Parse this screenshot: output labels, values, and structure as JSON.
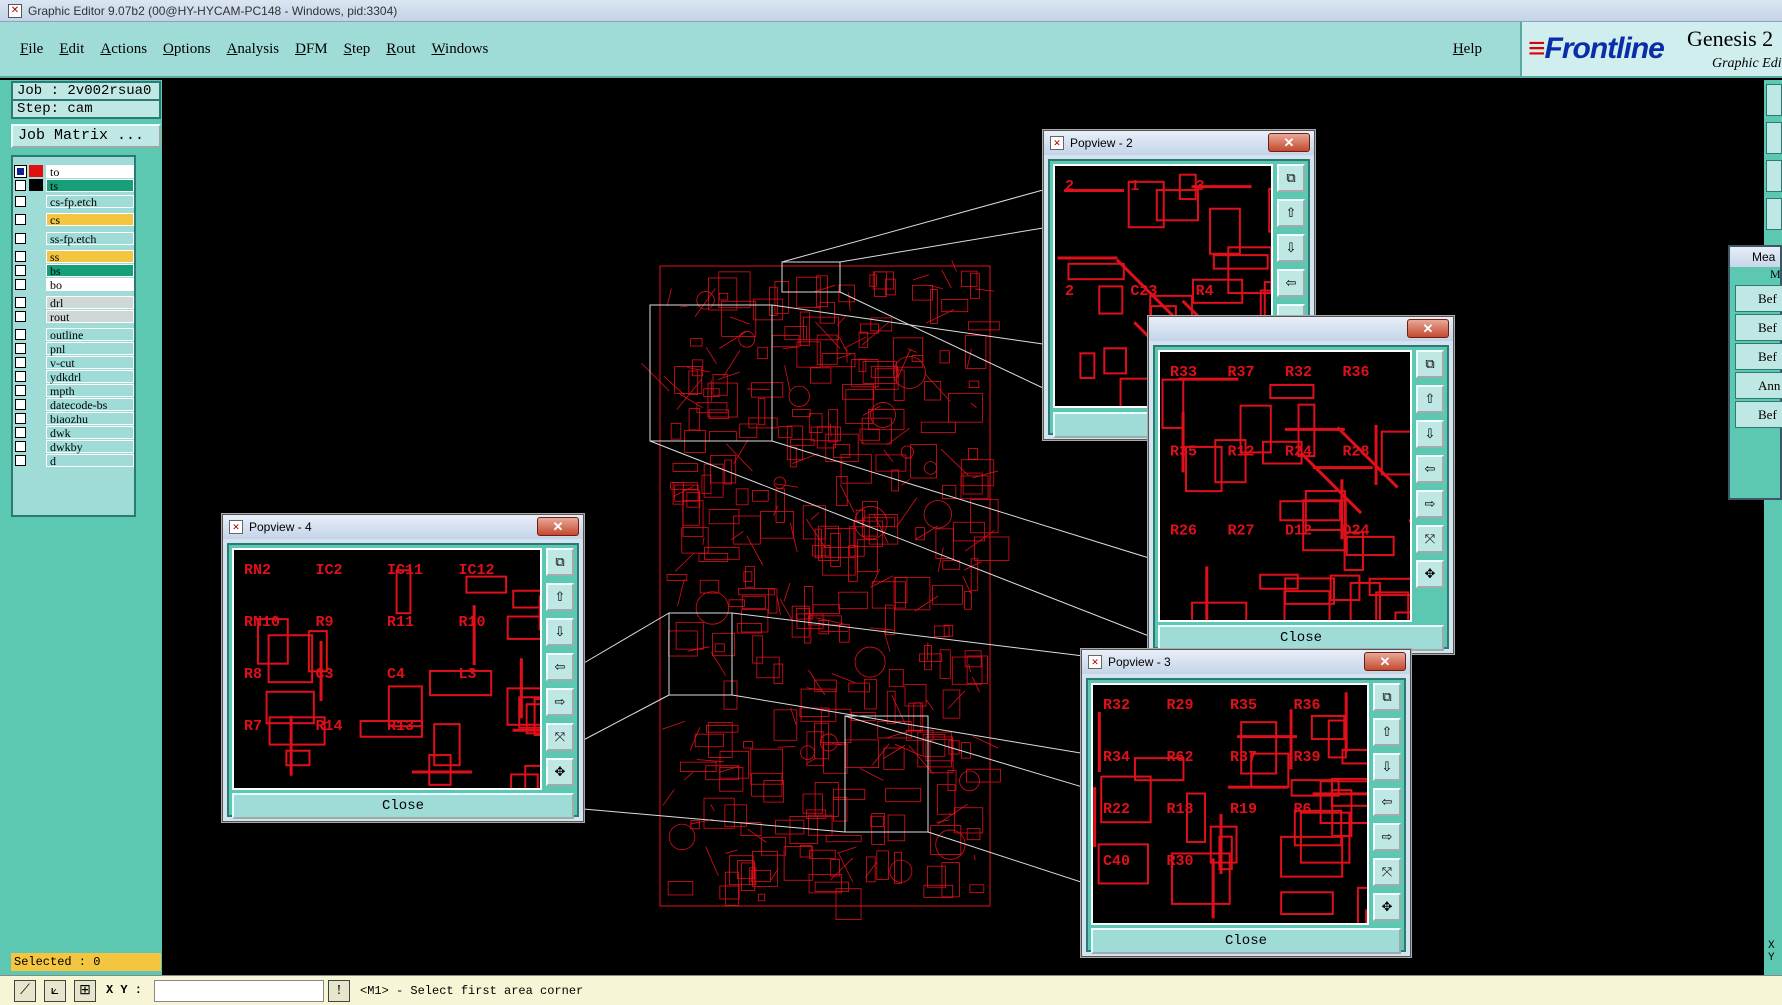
{
  "window": {
    "title": "Graphic Editor 9.07b2 (00@HY-HYCAM-PC148 - Windows, pid:3304)"
  },
  "menu": {
    "items": [
      "File",
      "Edit",
      "Actions",
      "Options",
      "Analysis",
      "DFM",
      "Step",
      "Rout",
      "Windows"
    ],
    "help": "Help"
  },
  "brand": {
    "logo": "Frontline",
    "product": "Genesis 2",
    "subtitle": "Graphic Edi"
  },
  "job": {
    "job_line": "Job : 2v002rsua0",
    "step_line": "Step: cam",
    "matrix_button": "Job Matrix ..."
  },
  "layers": [
    {
      "name": "to",
      "color": "#ffffff",
      "swatch": "#e01010",
      "active": true
    },
    {
      "name": "ts",
      "color": "#16a07a",
      "swatch": "#000000"
    },
    {
      "name": "cs-fp.etch",
      "color": "#9fdcd8"
    },
    {
      "name": "cs",
      "color": "#f4c540"
    },
    {
      "name": "ss-fp.etch",
      "color": "#9fdcd8"
    },
    {
      "name": "ss",
      "color": "#f4c540"
    },
    {
      "name": "bs",
      "color": "#16a07a"
    },
    {
      "name": "bo",
      "color": "#ffffff"
    },
    {
      "name": "drl",
      "color": "#cfd8d6"
    },
    {
      "name": "rout",
      "color": "#cfd8d6"
    },
    {
      "name": "outline",
      "color": "#9fdcd8"
    },
    {
      "name": "pnl",
      "color": "#9fdcd8"
    },
    {
      "name": "v-cut",
      "color": "#9fdcd8"
    },
    {
      "name": "ydkdrl",
      "color": "#9fdcd8"
    },
    {
      "name": "mpth",
      "color": "#9fdcd8"
    },
    {
      "name": "datecode-bs",
      "color": "#9fdcd8"
    },
    {
      "name": "biaozhu",
      "color": "#9fdcd8"
    },
    {
      "name": "dwk",
      "color": "#9fdcd8"
    },
    {
      "name": "dwkby",
      "color": "#9fdcd8"
    },
    {
      "name": "d",
      "color": "#9fdcd8"
    }
  ],
  "selected": "Selected : 0",
  "status": {
    "xy_label": "X Y :",
    "xy_value": "",
    "message": "<M1> - Select first area corner"
  },
  "measure": {
    "title": "Mea",
    "header": "M",
    "rows": [
      "Bef",
      "Bef",
      "Bef",
      "Ann",
      "Bef"
    ]
  },
  "right_xy": [
    "X",
    "Y"
  ],
  "popviews": {
    "p2": {
      "title": "Popview - 2",
      "close": "Close",
      "labels": [
        "2",
        "1",
        "3",
        "2",
        "C23",
        "R4"
      ]
    },
    "p3a": {
      "title": "",
      "close": "Close",
      "labels": [
        "R33",
        "R37",
        "R32",
        "R36",
        "R35",
        "R12",
        "R24",
        "R28",
        "R26",
        "R27",
        "D12",
        "D24"
      ]
    },
    "p3": {
      "title": "Popview - 3",
      "close": "Close",
      "labels": [
        "R32",
        "R29",
        "R35",
        "R36",
        "R34",
        "R62",
        "R37",
        "R39",
        "R22",
        "R18",
        "R19",
        "R6",
        "C40",
        "R30"
      ]
    },
    "p4": {
      "title": "Popview - 4",
      "close": "Close",
      "labels": [
        "RN2",
        "IC2",
        "IC11",
        "IC12",
        "RN10",
        "R9",
        "R11",
        "R10",
        "R8",
        "C3",
        "C4",
        "L3",
        "R7",
        "R14",
        "R13"
      ]
    }
  },
  "colors": {
    "trace": "#e0101a",
    "panel": "#5cc8b2",
    "menu": "#9fdcd8"
  }
}
